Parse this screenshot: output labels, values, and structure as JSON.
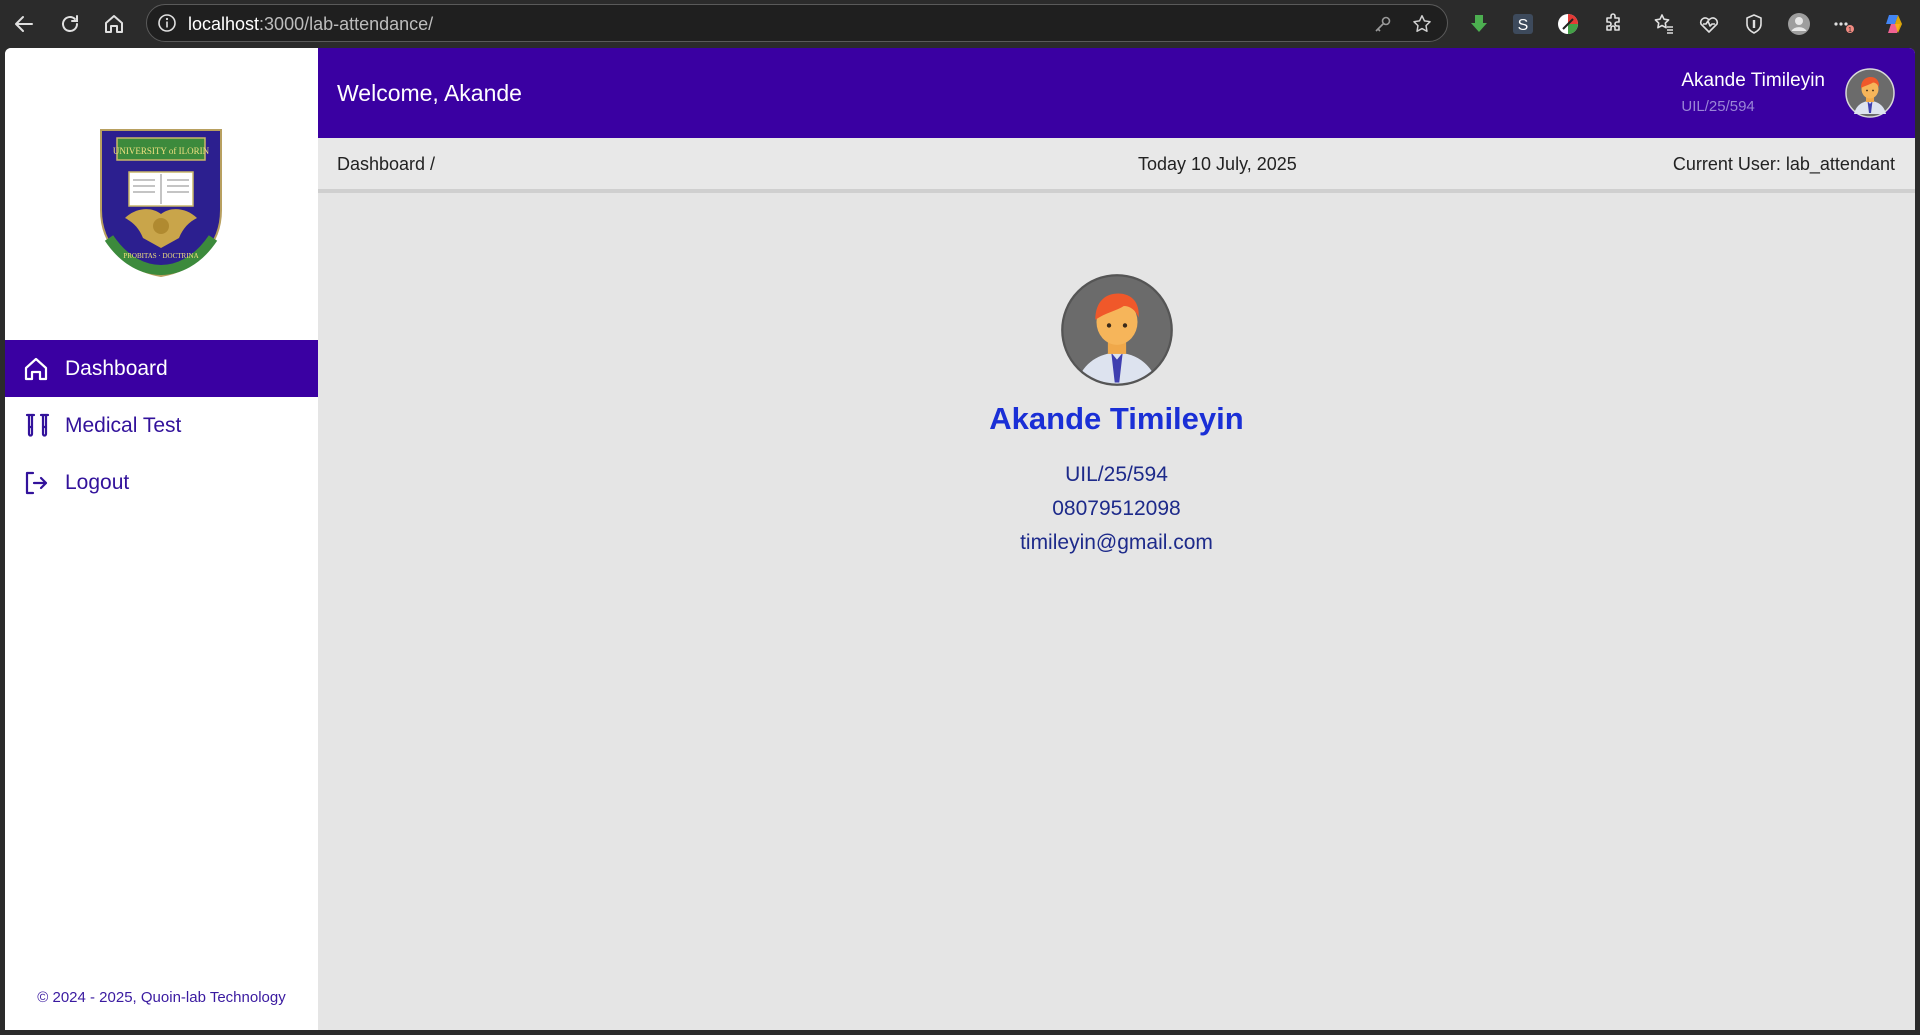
{
  "browser": {
    "url_host": "localhost",
    "url_path": ":3000/lab-attendance/",
    "colors": {
      "chrome_bg": "#2b2b2b"
    }
  },
  "sidebar": {
    "logo": {
      "banner_text": "UNIVERSITY of ILORIN",
      "motto_text": "PROBITAS · DOCTRINA"
    },
    "items": [
      {
        "label": "Dashboard",
        "icon": "home-icon",
        "active": true
      },
      {
        "label": "Medical Test",
        "icon": "test-tubes-icon",
        "active": false
      },
      {
        "label": "Logout",
        "icon": "logout-icon",
        "active": false
      }
    ],
    "copyright": "© 2024 - 2025, Quoin-lab Technology"
  },
  "header": {
    "welcome": "Welcome, Akande",
    "user_name": "Akande Timileyin",
    "user_id": "UIL/25/594",
    "colors": {
      "brand": "#3a00a2"
    }
  },
  "breadbar": {
    "breadcrumb": "Dashboard /",
    "today": "Today 10 July, 2025",
    "current_user": "Current User: lab_attendant"
  },
  "profile": {
    "name": "Akande Timileyin",
    "id": "UIL/25/594",
    "phone": "08079512098",
    "email": "timileyin@gmail.com",
    "colors": {
      "name": "#1a2fd6",
      "details": "#1d2a8a"
    }
  }
}
